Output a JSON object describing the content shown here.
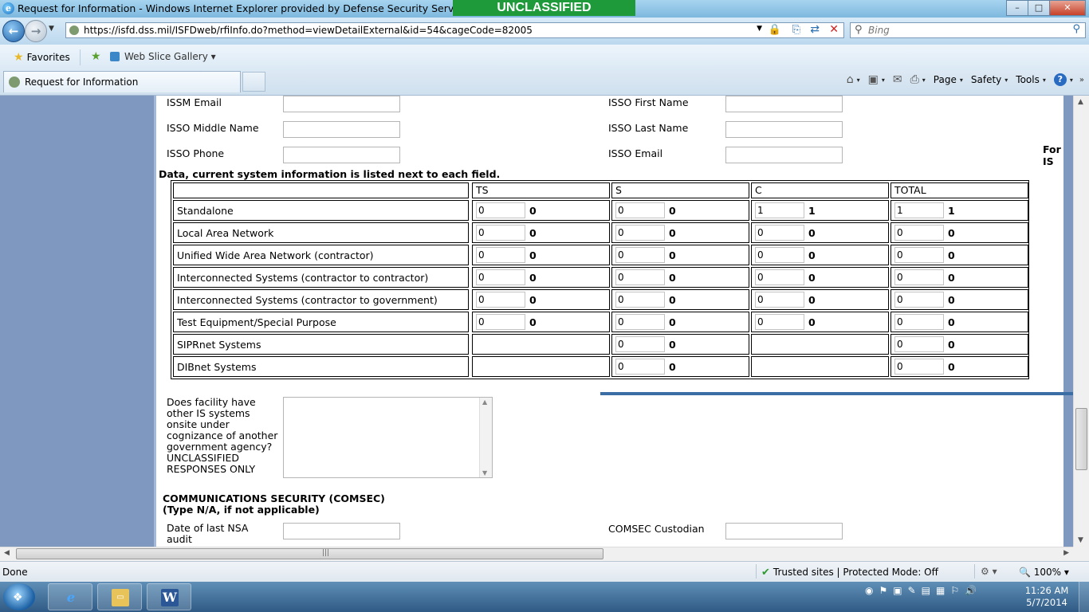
{
  "window": {
    "title": "Request for Information - Windows Internet Explorer provided by Defense Security Service",
    "classification": "UNCLASSIFIED",
    "btn_minimize": "–",
    "btn_maximize": "□",
    "btn_close": "✕"
  },
  "nav": {
    "back_glyph": "←",
    "forward_glyph": "→",
    "dropdown_glyph": "▼",
    "url": "https://isfd.dss.mil/ISFDweb/rfiInfo.do?method=viewDetailExternal&id=54&cageCode=82005",
    "search_placeholder": "Bing",
    "glyphs": {
      "lock": "🔒",
      "compat": "⎘",
      "refresh": "⇄",
      "stop": "✕",
      "search": "⚲",
      "go": "⚲"
    }
  },
  "favorites_bar": {
    "favorites_label": "Favorites",
    "web_slice_label": "Web Slice Gallery",
    "dropdown": "▾"
  },
  "tabs": [
    {
      "label": "Request for Information"
    }
  ],
  "command_bar": {
    "page": "Page",
    "safety": "Safety",
    "tools": "Tools",
    "help": "?",
    "arrow": "▾",
    "chevron": "»"
  },
  "form": {
    "issm_email_label": "ISSM Email",
    "isso_first_name_label": "ISSO First Name",
    "isso_middle_name_label": "ISSO Middle Name",
    "isso_last_name_label": "ISSO Last Name",
    "isso_phone_label": "ISSO Phone",
    "isso_email_label": "ISSO Email",
    "right_cut_text": "For IS",
    "data_note": "Data, current system information is listed next to each field.",
    "other_is_question": "Does facility have other IS systems onsite under cognizance of another government agency? UNCLASSIFIED RESPONSES ONLY",
    "comsec_heading": "COMMUNICATIONS SECURITY (COMSEC)",
    "comsec_sub": "(Type N/A, if not applicable)",
    "nsa_audit_label": "Date of last NSA audit",
    "comsec_custodian_label": "COMSEC Custodian"
  },
  "system_table": {
    "columns": [
      "TS",
      "S",
      "C",
      "TOTAL"
    ],
    "rows": [
      {
        "label": "Standalone",
        "cells": [
          {
            "input": "0",
            "current": "0"
          },
          {
            "input": "0",
            "current": "0"
          },
          {
            "input": "1",
            "current": "1"
          },
          {
            "input": "1",
            "current": "1"
          }
        ]
      },
      {
        "label": "Local Area Network",
        "cells": [
          {
            "input": "0",
            "current": "0"
          },
          {
            "input": "0",
            "current": "0"
          },
          {
            "input": "0",
            "current": "0"
          },
          {
            "input": "0",
            "current": "0"
          }
        ]
      },
      {
        "label": "Unified Wide Area Network (contractor)",
        "cells": [
          {
            "input": "0",
            "current": "0"
          },
          {
            "input": "0",
            "current": "0"
          },
          {
            "input": "0",
            "current": "0"
          },
          {
            "input": "0",
            "current": "0"
          }
        ]
      },
      {
        "label": "Interconnected Systems (contractor to contractor)",
        "cells": [
          {
            "input": "0",
            "current": "0"
          },
          {
            "input": "0",
            "current": "0"
          },
          {
            "input": "0",
            "current": "0"
          },
          {
            "input": "0",
            "current": "0"
          }
        ]
      },
      {
        "label": "Interconnected Systems (contractor to government)",
        "cells": [
          {
            "input": "0",
            "current": "0"
          },
          {
            "input": "0",
            "current": "0"
          },
          {
            "input": "0",
            "current": "0"
          },
          {
            "input": "0",
            "current": "0"
          }
        ]
      },
      {
        "label": "Test Equipment/Special Purpose",
        "cells": [
          {
            "input": "0",
            "current": "0"
          },
          {
            "input": "0",
            "current": "0"
          },
          {
            "input": "0",
            "current": "0"
          },
          {
            "input": "0",
            "current": "0"
          }
        ]
      },
      {
        "label": "SIPRnet Systems",
        "cells": [
          null,
          {
            "input": "0",
            "current": "0"
          },
          null,
          {
            "input": "0",
            "current": "0"
          }
        ]
      },
      {
        "label": "DIBnet Systems",
        "cells": [
          null,
          {
            "input": "0",
            "current": "0"
          },
          null,
          {
            "input": "0",
            "current": "0"
          }
        ]
      }
    ]
  },
  "statusbar": {
    "status": "Done",
    "zone": "Trusted sites | Protected Mode: Off",
    "zoom": "100%",
    "check_glyph": "✔",
    "zoom_ctl_glyph": "⚙ ▾",
    "zoom_arrow": "▾"
  },
  "scroll": {
    "up": "▲",
    "down": "▼",
    "left": "◀",
    "right": "▶",
    "grip": "|||"
  },
  "taskbar": {
    "start_glyph": "❖",
    "ie_glyph": "e",
    "folder_glyph": "▭",
    "word_glyph": "W",
    "tray_icons": [
      "◉",
      "⚑",
      "▣",
      "✎",
      "▤",
      "▦",
      "⚐",
      "🔊"
    ],
    "time": "11:26 AM",
    "date": "5/7/2014"
  }
}
